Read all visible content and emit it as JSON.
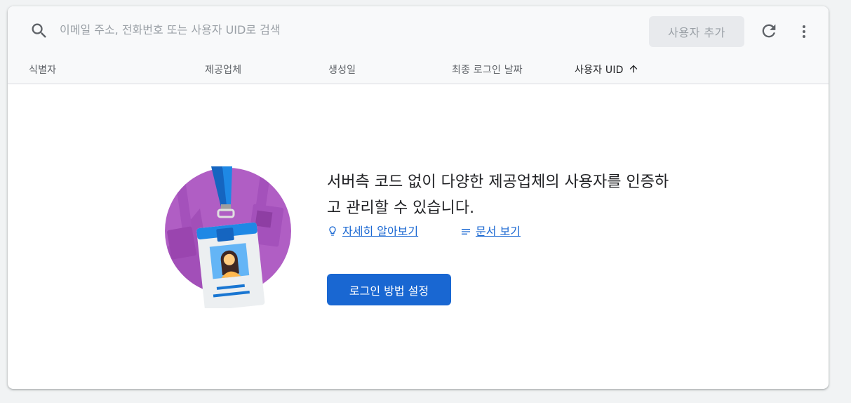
{
  "search": {
    "placeholder": "이메일 주소, 전화번호 또는 사용자 UID로 검색"
  },
  "toolbar": {
    "add_user_label": "사용자 추가",
    "icons": [
      "search-icon",
      "refresh-icon",
      "more-vert-icon"
    ]
  },
  "table": {
    "columns": [
      "식별자",
      "제공업체",
      "생성일",
      "최종 로그인 날짜",
      "사용자 UID"
    ],
    "sorted_column": "사용자 UID",
    "sort_direction": "ascending"
  },
  "empty_state": {
    "title": "서버측 코드 없이 다양한 제공업체의 사용자를 인증하고 관리할 수 있습니다.",
    "learn_more_label": "자세히 알아보기",
    "docs_label": "문서 보기",
    "setup_button_label": "로그인 방법 설정"
  },
  "colors": {
    "accent": "#1967d2",
    "illustration_purple": "#b05ec4",
    "header_bg": "#f8f9fa"
  }
}
